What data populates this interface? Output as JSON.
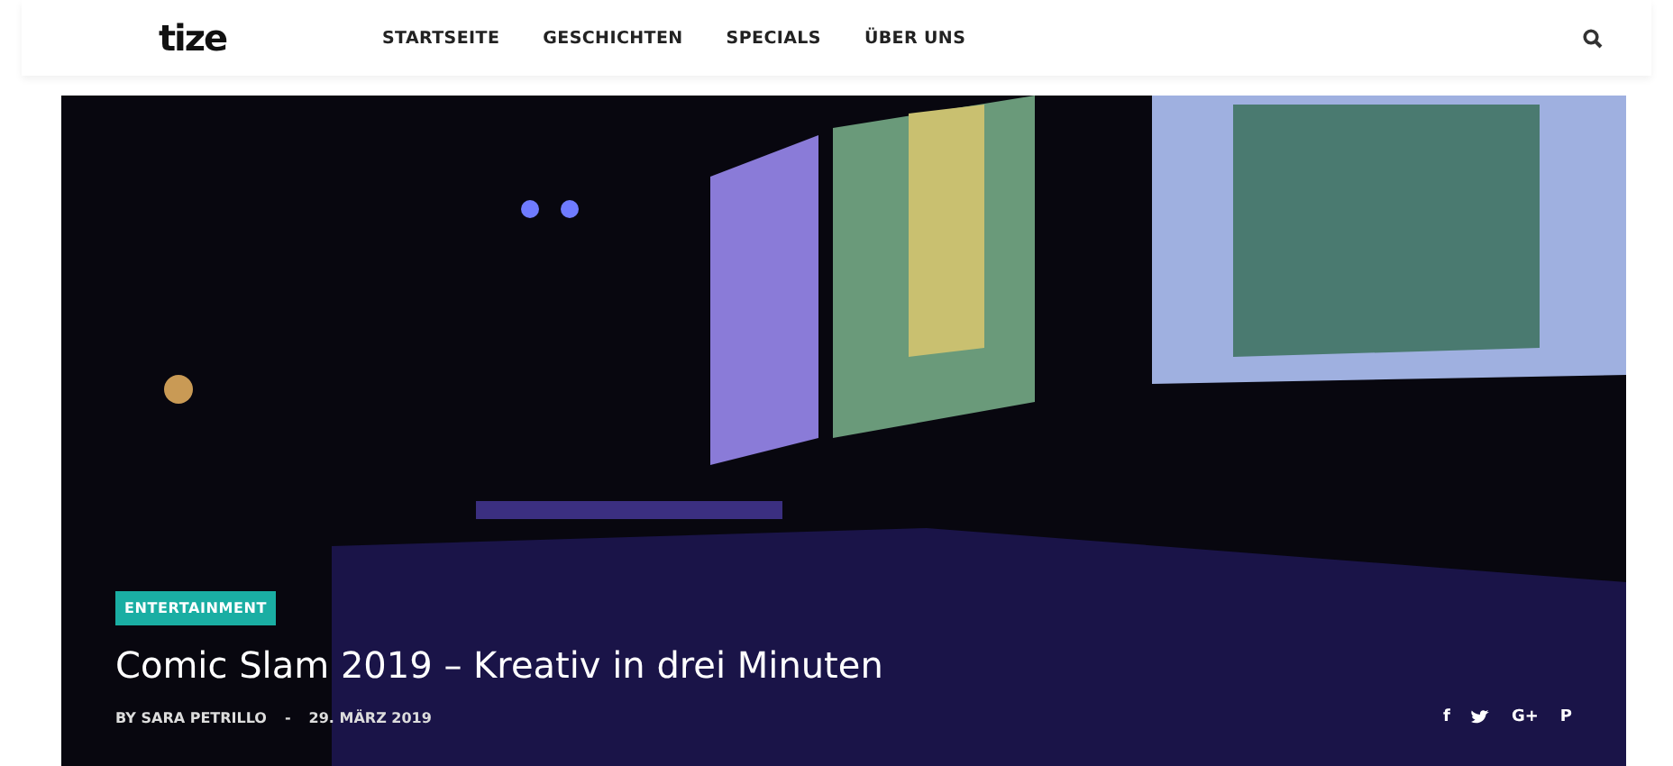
{
  "header": {
    "logo": "tize",
    "nav": [
      {
        "label": "STARTSEITE"
      },
      {
        "label": "GESCHICHTEN"
      },
      {
        "label": "SPECIALS"
      },
      {
        "label": "ÜBER UNS"
      }
    ]
  },
  "hero": {
    "category": "ENTERTAINMENT",
    "title": "Comic Slam 2019 – Kreativ in drei Minuten",
    "author": "BY SARA PETRILLO",
    "separator": "-",
    "date": "29. MÄRZ 2019",
    "share": [
      {
        "kind": "text",
        "label": "f"
      },
      {
        "kind": "bird"
      },
      {
        "kind": "text",
        "label": "G+"
      },
      {
        "kind": "text",
        "label": "P"
      }
    ]
  }
}
